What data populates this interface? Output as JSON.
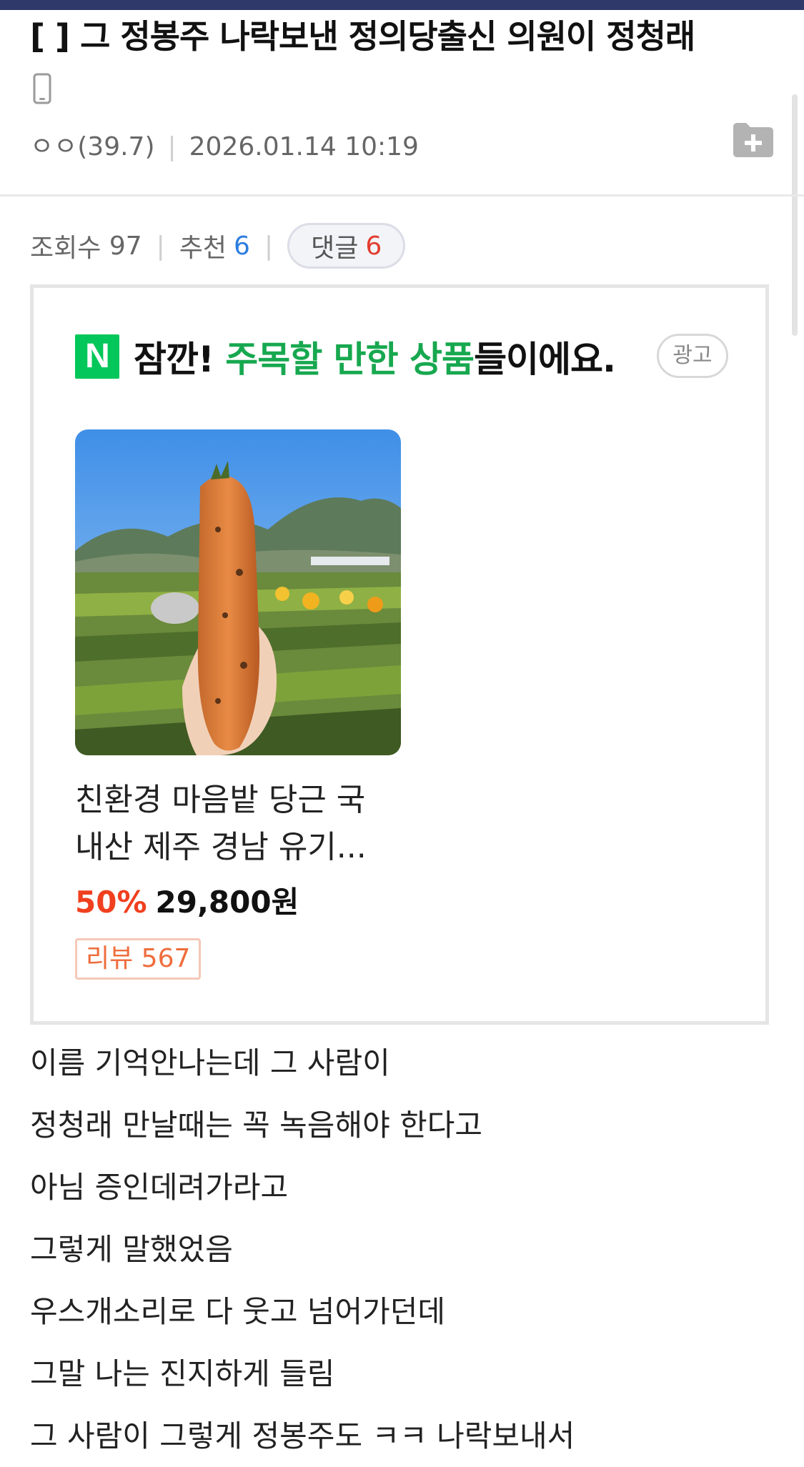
{
  "post": {
    "title": "[   ] 그 정봉주 나락보낸 정의당출신 의원이 정청래",
    "author": "ㅇㅇ(39.7)",
    "datetime": "2026.01.14 10:19",
    "views_label": "조회수",
    "views": "97",
    "recommend_label": "추천",
    "recommend": "6",
    "comments_label": "댓글",
    "comments": "6"
  },
  "icons": {
    "device": "mobile-device-icon",
    "folder": "folder-add-icon"
  },
  "ad": {
    "logo_letter": "N",
    "heading_prefix": "잠깐! ",
    "heading_highlight": "주목할 만한 상품",
    "heading_suffix": "들이에요.",
    "badge": "광고",
    "product": {
      "name": "친환경 마음밭 당근 국내산 제주 경남 유기...",
      "discount": "50%",
      "price": "29,800",
      "currency": "원",
      "review": "리뷰 567"
    }
  },
  "body_lines": [
    "이름 기억안나는데 그 사람이",
    "정청래 만날때는 꼭 녹음해야 한다고",
    "아님 증인데려가라고",
    "그렇게 말했었음",
    "우스개소리로 다 웃고 넘어가던데",
    "그말 나는 진지하게 들림",
    "그 사람이 그렇게 정봉주도 ㅋㅋ 나락보내서"
  ],
  "colors": {
    "topbar": "#2f3a6b",
    "naver_green": "#03c75a",
    "highlight_green": "#17a84f",
    "recommend_blue": "#2c7de0",
    "comment_red": "#e23c2e",
    "discount_red": "#f0401f"
  }
}
